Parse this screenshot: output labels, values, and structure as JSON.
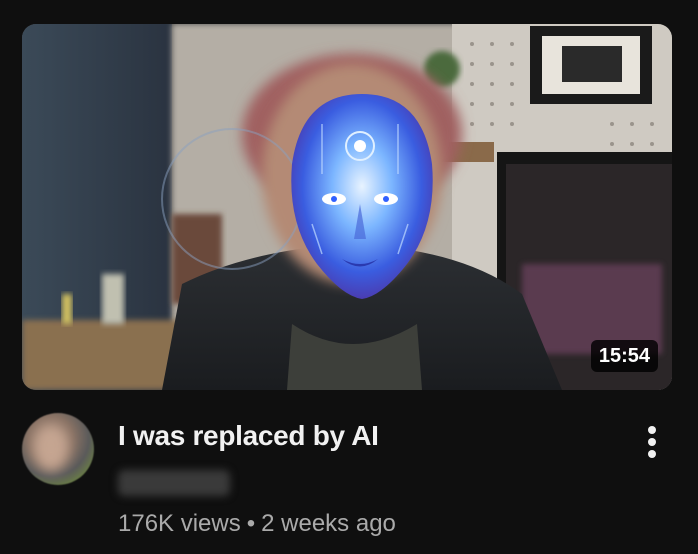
{
  "video": {
    "duration": "15:54",
    "title": "I was replaced by AI",
    "channel": "",
    "views": "176K views",
    "separator": "•",
    "age": "2 weeks ago"
  },
  "icons": {
    "menu": "more-vert-icon"
  },
  "colors": {
    "background": "#0f0f0f",
    "title": "#f1f1f1",
    "meta": "#aaaaaa",
    "duration_bg": "#000000cc"
  }
}
